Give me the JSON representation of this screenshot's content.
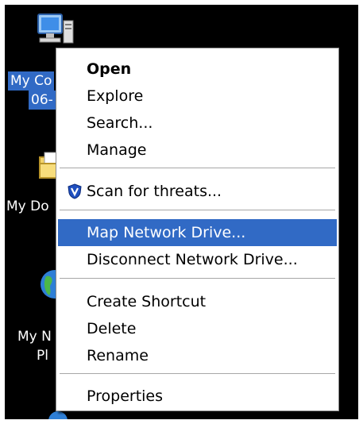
{
  "desktop": {
    "icons": [
      {
        "name": "My Computer",
        "label_line1": "My Co",
        "label_line2": "06-"
      },
      {
        "name": "My Documents",
        "label_line1": "My Do"
      },
      {
        "name": "My Network Places",
        "label_line1": "My N",
        "label_line2": "Pl"
      }
    ]
  },
  "context_menu": {
    "items": [
      {
        "label": "Open",
        "bold": true
      },
      {
        "label": "Explore"
      },
      {
        "label": "Search..."
      },
      {
        "label": "Manage"
      },
      {
        "label": "Scan for threats...",
        "icon": "shield-v-icon"
      },
      {
        "label": "Map Network Drive...",
        "highlighted": true
      },
      {
        "label": "Disconnect Network Drive..."
      },
      {
        "label": "Create Shortcut"
      },
      {
        "label": "Delete"
      },
      {
        "label": "Rename"
      },
      {
        "label": "Properties"
      }
    ]
  },
  "colors": {
    "selection": "#316ac5",
    "desktop_background": "#000000",
    "menu_background": "#ffffff"
  }
}
